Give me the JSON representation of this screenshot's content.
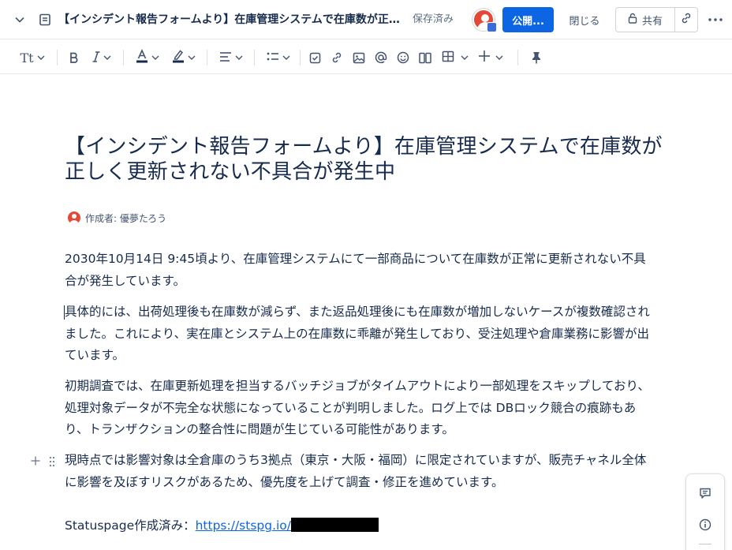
{
  "header": {
    "doc_title": "【インシデント報告フォームより】在庫管理システムで在庫数が正し...",
    "saved_status": "保存済み",
    "publish_label": "公開...",
    "close_label": "閉じる",
    "share_label": "共有"
  },
  "toolbar": {
    "text_style_label": "Tt"
  },
  "page": {
    "title": "【インシデント報告フォームより】在庫管理システムで在庫数が正しく更新されない不具合が発生中",
    "byline": "作成者: 優夢たろう",
    "paragraphs": [
      "2030年10月14日 9:45頃より、在庫管理システムにて一部商品について在庫数が正常に更新されない不具合が発生しています。",
      "具体的には、出荷処理後も在庫数が減らず、また返品処理後にも在庫数が増加しないケースが複数確認されました。これにより、実在庫とシステム上の在庫数に乖離が発生しており、受注処理や倉庫業務に影響が出ています。",
      "初期調査では、在庫更新処理を担当するバッチジョブがタイムアウトにより一部処理をスキップしており、処理対象データが不完全な状態になっていることが判明しました。ログ上では DBロック競合の痕跡もあり、トランザクションの整合性に問題が生じている可能性があります。",
      "現時点では影響対象は全倉庫のうち3拠点（東京・大阪・福岡）に限定されていますが、販売チャネル全体に影響を及ぼすリスクがあるため、優先度を上げて調査・修正を進めています。"
    ],
    "statuspage_label": "Statuspage作成済み：",
    "statuspage_link": "https://stspg.io/"
  },
  "colors": {
    "accent": "#0c66e4",
    "avatar": "#e34935",
    "text": "#172b4d",
    "subtle": "#44546f"
  },
  "icons": [
    "chevron-down-icon",
    "page-icon",
    "avatar-icon",
    "link-icon",
    "lock-icon",
    "more-icon",
    "bold-icon",
    "italic-icon",
    "text-color-icon",
    "highlight-icon",
    "align-icon",
    "bullet-list-icon",
    "task-icon",
    "image-icon",
    "mention-icon",
    "emoji-icon",
    "layout-icon",
    "table-icon",
    "insert-icon",
    "pin-icon",
    "comment-icon",
    "info-icon"
  ]
}
